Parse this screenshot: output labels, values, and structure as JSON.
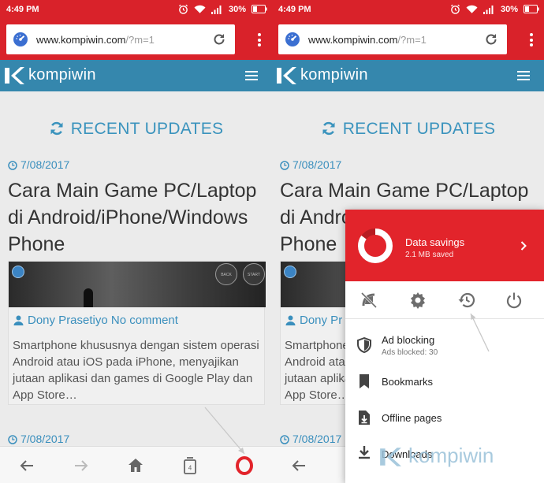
{
  "status": {
    "time": "4:49 PM",
    "battery": "30%"
  },
  "address": {
    "url_main": "www.kompiwin.com",
    "url_path": "/?m=1"
  },
  "site": {
    "name": "kompiwin"
  },
  "content": {
    "heading": "RECENT UPDATES",
    "post": {
      "date": "7/08/2017",
      "title": "Cara Main Game PC/Laptop di Android/iPhone/Windows Phone",
      "author": "Dony Prasetiyo",
      "author_short": "Dony Pr",
      "comments": "No comment",
      "excerpt": "Smartphone khususnya dengan sistem operasi Android atau iOS pada iPhone, menyajikan jutaan aplikasi dan games di Google Play dan App Store…",
      "thumb_badges": [
        "BACK",
        "START"
      ]
    },
    "next_date": "7/08/2017"
  },
  "bottombar": {
    "tab_count": "4"
  },
  "menu": {
    "savings_title": "Data savings",
    "savings_sub": "2.1 MB saved",
    "savings_fraction": 0.85,
    "items": [
      {
        "label": "Ad blocking",
        "sub": "Ads blocked: 30",
        "icon": "shield-icon"
      },
      {
        "label": "Bookmarks",
        "icon": "bookmark-icon"
      },
      {
        "label": "Offline pages",
        "icon": "offline-page-icon"
      },
      {
        "label": "Downloads",
        "icon": "download-icon"
      }
    ],
    "row_icons": [
      "satellite-off-icon",
      "settings-icon",
      "history-icon",
      "power-icon"
    ]
  },
  "watermark": "kompiwin",
  "colors": {
    "opera_red": "#d9222a",
    "site_blue": "#3587ad",
    "link_blue": "#3a8fbd"
  }
}
